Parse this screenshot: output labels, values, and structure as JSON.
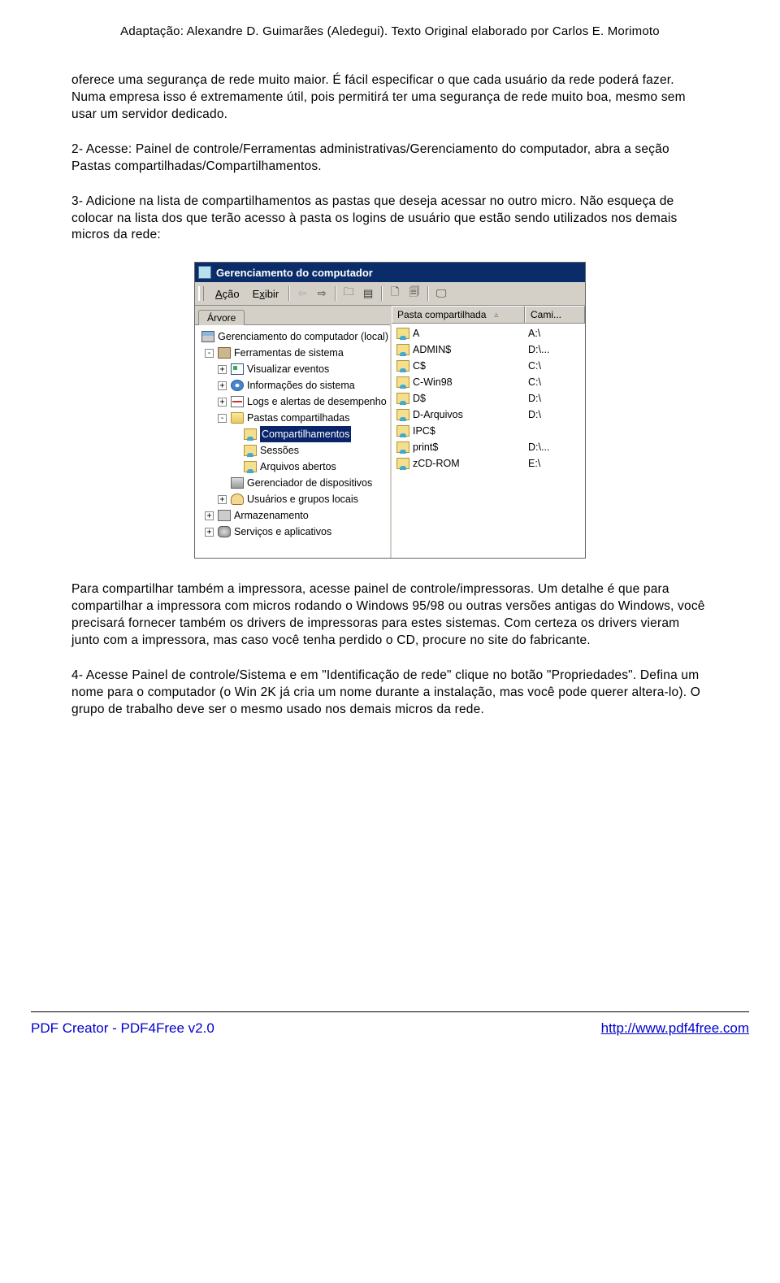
{
  "header": "Adaptação: Alexandre D. Guimarães (Aledegui). Texto Original elaborado por Carlos E. Morimoto",
  "p1": "oferece uma segurança de rede muito maior. É fácil especificar o que cada usuário da rede poderá fazer. Numa empresa isso é extremamente útil, pois permitirá ter uma segurança de rede muito boa, mesmo sem usar um servidor dedicado.",
  "p2": "2- Acesse: Painel de controle/Ferramentas administrativas/Gerenciamento do computador, abra a seção Pastas compartilhadas/Compartilhamentos.",
  "p3": "3- Adicione na lista de compartilhamentos as pastas que deseja acessar no outro micro. Não esqueça de colocar na lista dos que terão acesso à pasta os logins de usuário que estão sendo utilizados nos demais micros da rede:",
  "p4": "Para compartilhar também a impressora, acesse painel de controle/impressoras. Um detalhe é que para compartilhar a impressora com micros rodando o Windows 95/98 ou outras versões antigas do Windows, você precisará fornecer também os drivers de impressoras para estes sistemas. Com certeza os drivers vieram junto com a impressora, mas caso você tenha perdido o CD, procure no site do fabricante.",
  "p5": "4- Acesse Painel de controle/Sistema e em \"Identificação de rede\" clique no botão \"Propriedades\". Defina um nome para o computador (o Win 2K já cria um nome durante a instalação, mas você pode querer altera-lo). O grupo de trabalho deve ser o mesmo usado nos demais micros da rede.",
  "win": {
    "title": "Gerenciamento do computador",
    "menu_acao": "Ação",
    "menu_exibir": "Exibir",
    "tab_arvore": "Árvore",
    "col_pasta": "Pasta compartilhada",
    "col_cami": "Cami...",
    "tree": {
      "root": "Gerenciamento do computador (local)",
      "ferramentas": "Ferramentas de sistema",
      "visualizar": "Visualizar eventos",
      "info": "Informações do sistema",
      "logs": "Logs e alertas de desempenho",
      "pastas": "Pastas compartilhadas",
      "compart": "Compartilhamentos",
      "sessoes": "Sessões",
      "arquivos": "Arquivos abertos",
      "gerdisp": "Gerenciador de dispositivos",
      "usuarios": "Usuários e grupos locais",
      "armaz": "Armazenamento",
      "servicos": "Serviços e aplicativos"
    },
    "shares": [
      {
        "name": "A",
        "path": "A:\\"
      },
      {
        "name": "ADMIN$",
        "path": "D:\\..."
      },
      {
        "name": "C$",
        "path": "C:\\"
      },
      {
        "name": "C-Win98",
        "path": "C:\\"
      },
      {
        "name": "D$",
        "path": "D:\\"
      },
      {
        "name": "D-Arquivos",
        "path": "D:\\"
      },
      {
        "name": "IPC$",
        "path": ""
      },
      {
        "name": "print$",
        "path": "D:\\..."
      },
      {
        "name": "zCD-ROM",
        "path": "E:\\"
      }
    ]
  },
  "footer": {
    "left": "PDF Creator - PDF4Free v2.0",
    "right": "http://www.pdf4free.com"
  }
}
